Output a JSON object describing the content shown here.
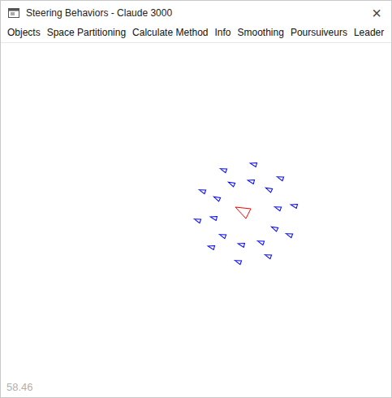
{
  "window": {
    "title": "Steering Behaviors - Claude 3000",
    "close": "×"
  },
  "menu": [
    {
      "label": "Objects"
    },
    {
      "label": "Space Partitioning"
    },
    {
      "label": "Calculate Method"
    },
    {
      "label": "Info"
    },
    {
      "label": "Smoothing"
    },
    {
      "label": "Poursuiveurs"
    },
    {
      "label": "Leader"
    }
  ],
  "agents": [
    {
      "kind": "pursuer",
      "color": "#0000ff"
    },
    {
      "kind": "pursuer",
      "color": "#0000ff"
    },
    {
      "kind": "pursuer",
      "color": "#0000ff"
    },
    {
      "kind": "pursuer",
      "color": "#0000ff"
    },
    {
      "kind": "pursuer",
      "color": "#0000ff"
    },
    {
      "kind": "pursuer",
      "color": "#0000ff"
    },
    {
      "kind": "pursuer",
      "color": "#0000ff"
    },
    {
      "kind": "pursuer",
      "color": "#0000ff"
    },
    {
      "kind": "pursuer",
      "color": "#0000ff"
    },
    {
      "kind": "pursuer",
      "color": "#0000ff"
    },
    {
      "kind": "pursuer",
      "color": "#0000ff"
    },
    {
      "kind": "pursuer",
      "color": "#0000ff"
    },
    {
      "kind": "pursuer",
      "color": "#0000ff"
    },
    {
      "kind": "pursuer",
      "color": "#0000ff"
    },
    {
      "kind": "pursuer",
      "color": "#0000ff"
    },
    {
      "kind": "pursuer",
      "color": "#0000ff"
    },
    {
      "kind": "pursuer",
      "color": "#0000ff"
    },
    {
      "kind": "pursuer",
      "color": "#0000ff"
    },
    {
      "kind": "pursuer",
      "color": "#0000ff"
    },
    {
      "kind": "pursuer",
      "color": "#0000ff"
    },
    {
      "kind": "leader",
      "color": "#ff0000"
    }
  ],
  "fps": "58.46"
}
